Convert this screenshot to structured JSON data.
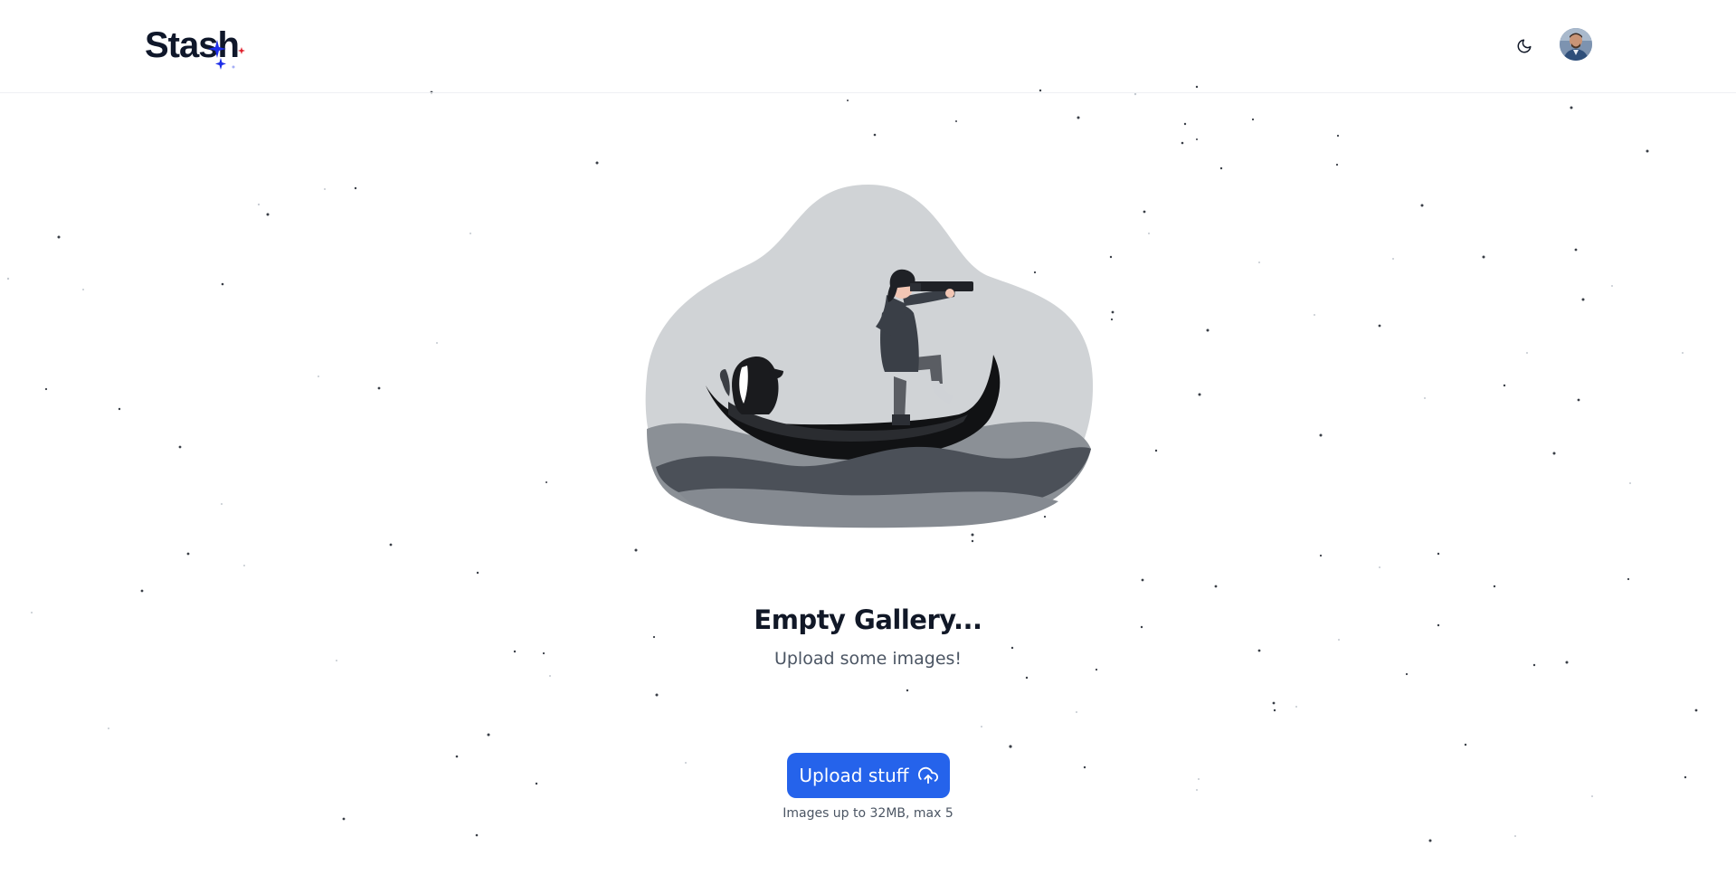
{
  "app": {
    "logo_text": "Stash",
    "logo_name": "stash-logo"
  },
  "header": {
    "theme_toggle_icon": "moon-icon",
    "avatar_icon": "user-avatar"
  },
  "empty_state": {
    "illustration": "boat-telescope-illustration",
    "title": "Empty Gallery...",
    "subtitle": "Upload some images!"
  },
  "upload": {
    "button_label": "Upload stuff",
    "button_icon": "cloud-upload-icon",
    "hint": "Images up to 32MB, max 5"
  },
  "colors": {
    "accent": "#2563eb",
    "text_primary": "#111827",
    "text_secondary": "#4b5563",
    "background": "#ffffff"
  }
}
